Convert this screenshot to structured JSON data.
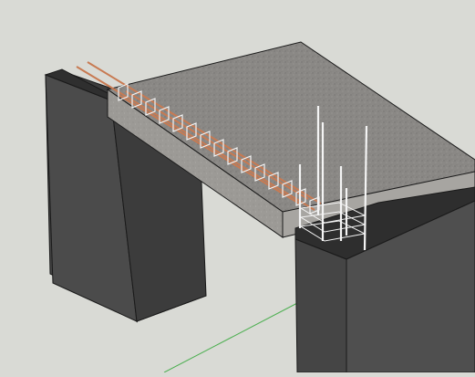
{
  "scene": {
    "description_hidden": "",
    "colors": {
      "background": "#d9dad5",
      "wall_front": "#4a4a4a",
      "wall_side": "#3a3a3a",
      "wall_top": "#2f2f2f",
      "slab_top": "#8a8885",
      "slab_edge": "#9b9995",
      "rebar_copper": "#c87a52",
      "rebar_white": "#f2f2f2",
      "edges": "#1a1a1a",
      "axis_green": "#4caf50"
    }
  }
}
